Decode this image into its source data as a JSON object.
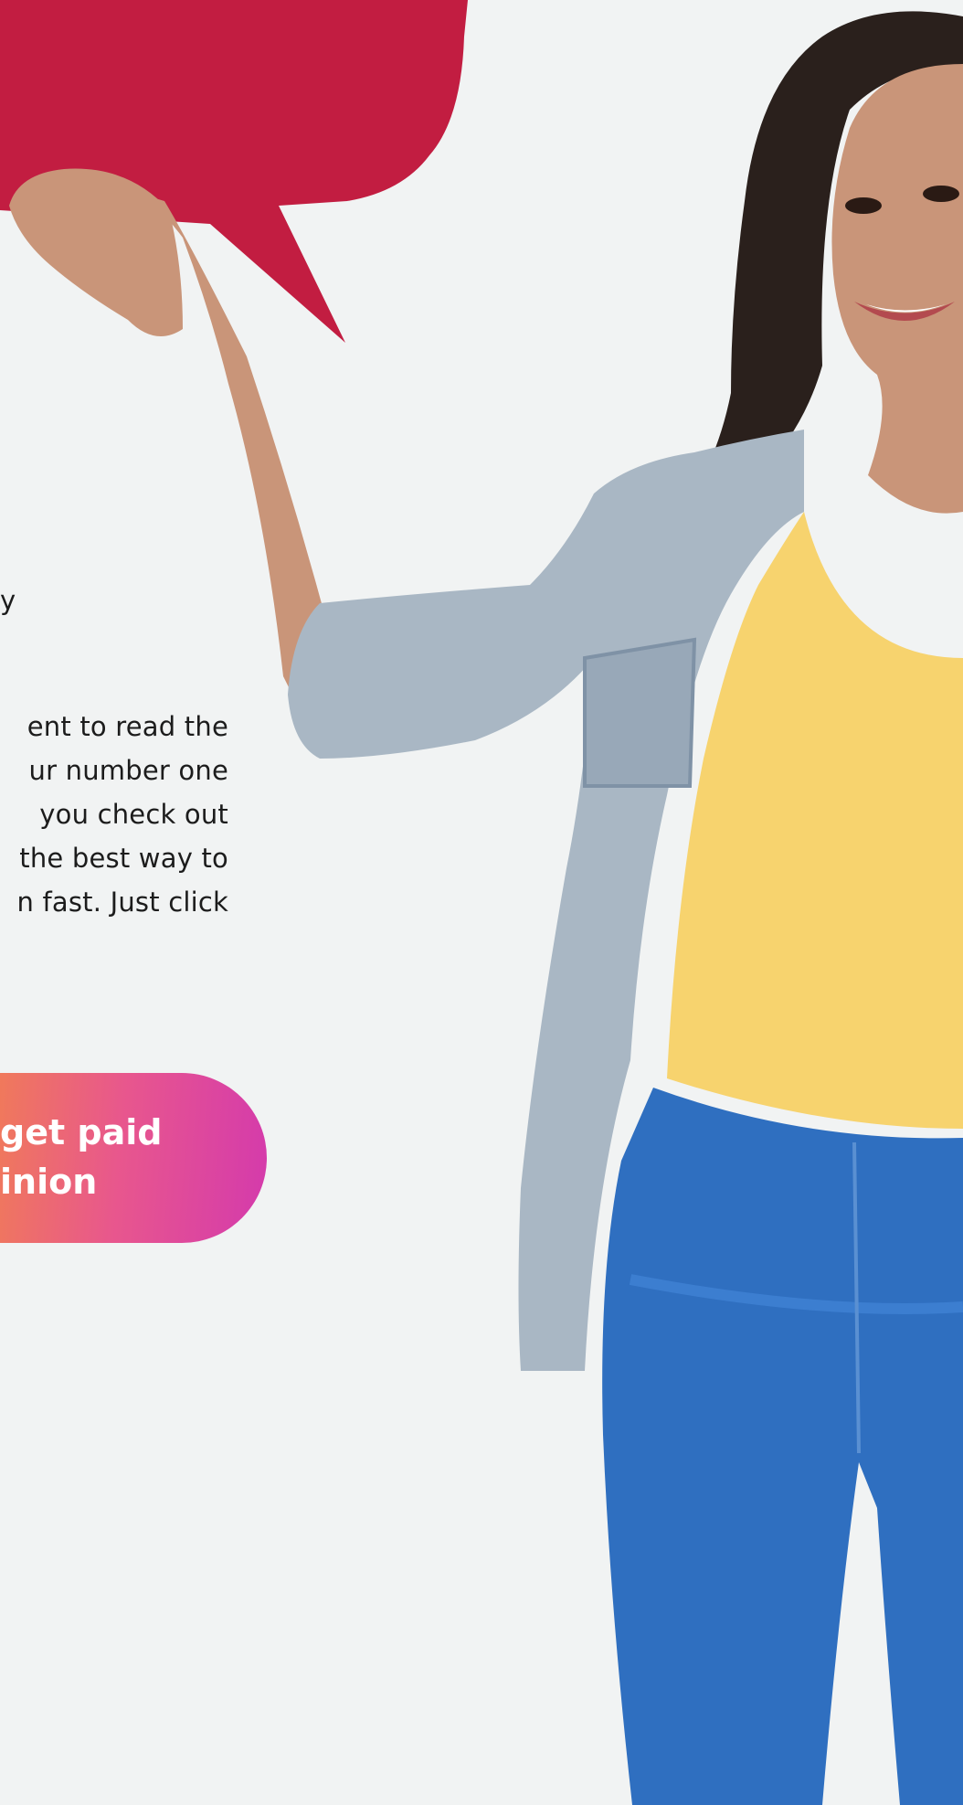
{
  "fragment": {
    "orphan_letter": "y",
    "body_lines": [
      "ent to read the",
      "ur number one",
      "you check out",
      "the best way to",
      "n fast. Just click"
    ]
  },
  "cta": {
    "line1": "get paid",
    "line2": "inion"
  },
  "colors": {
    "speech_bubble": "#c21d41",
    "background": "#f2f4f4",
    "cta_gradient_start": "#f17e54",
    "cta_gradient_end": "#d43aac",
    "shirt": "#f7d36e",
    "jeans": "#2f6fc0",
    "jacket": "#a9b7c4"
  }
}
